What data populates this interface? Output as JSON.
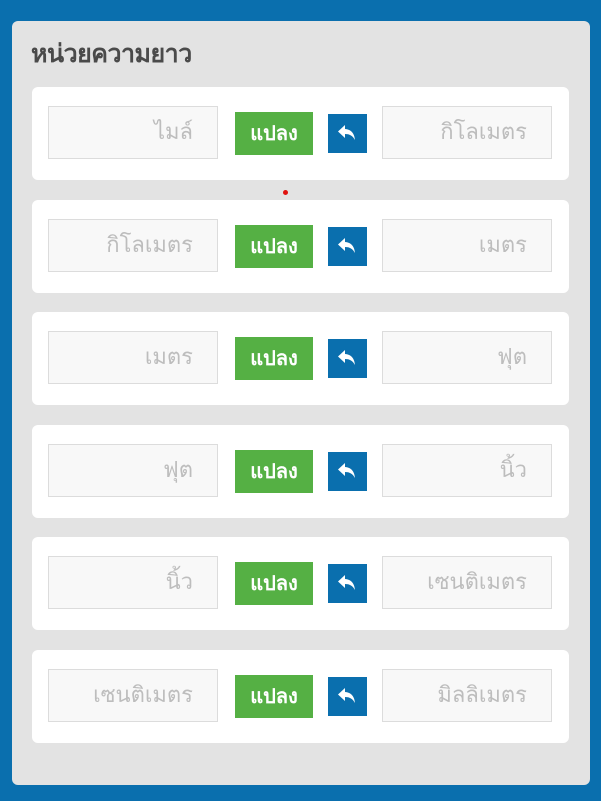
{
  "panel": {
    "title": "หน่วยความยาว"
  },
  "rows": [
    {
      "from": "ไมล์",
      "to": "กิโลเมตร",
      "convert_label": "แปลง"
    },
    {
      "from": "กิโลเมตร",
      "to": "เมตร",
      "convert_label": "แปลง"
    },
    {
      "from": "เมตร",
      "to": "ฟุต",
      "convert_label": "แปลง"
    },
    {
      "from": "ฟุต",
      "to": "นิ้ว",
      "convert_label": "แปลง"
    },
    {
      "from": "นิ้ว",
      "to": "เซนติเมตร",
      "convert_label": "แปลง"
    },
    {
      "from": "เซนติเมตร",
      "to": "มิลลิเมตร",
      "convert_label": "แปลง"
    }
  ],
  "icons": {
    "swap": "reply-arrow-icon"
  },
  "colors": {
    "background": "#0a6fae",
    "panel": "#e3e3e3",
    "convert_button": "#55b044",
    "swap_button": "#0a6fae",
    "placeholder_text": "#bdbdbd"
  }
}
